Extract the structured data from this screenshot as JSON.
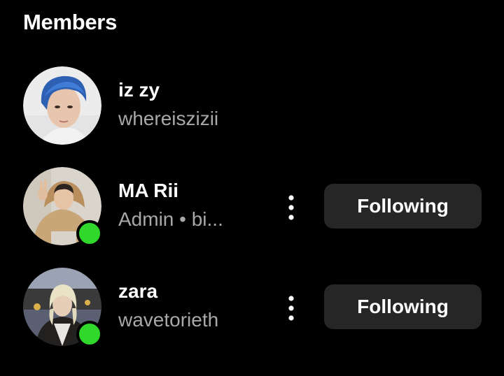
{
  "section": {
    "title": "Members"
  },
  "members": [
    {
      "name": "iz zy",
      "subtitle": "whereiszizii",
      "online": false,
      "follow_label": ""
    },
    {
      "name": "MA Rii",
      "subtitle": "Admin • bi...",
      "online": true,
      "follow_label": "Following"
    },
    {
      "name": "zara",
      "subtitle": "wavetorieth",
      "online": true,
      "follow_label": "Following"
    }
  ],
  "colors": {
    "background": "#000000",
    "button_bg": "#262626",
    "online": "#2fd82b",
    "secondary_text": "#a8a8a8"
  },
  "icons": {
    "more": "more-vertical-icon",
    "online": "online-status-icon"
  }
}
